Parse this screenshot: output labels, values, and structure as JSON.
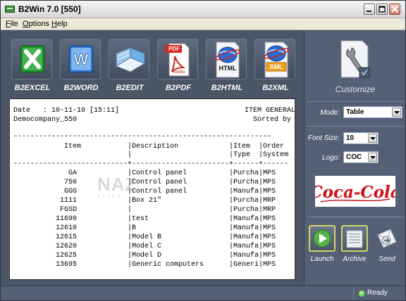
{
  "window": {
    "title": "B2Win 7.0 [550]"
  },
  "menu": {
    "file": {
      "first": "F",
      "rest": "ile"
    },
    "options": {
      "first": "O",
      "rest": "ptions"
    },
    "help": {
      "first": "H",
      "rest": "elp"
    }
  },
  "toolbar": {
    "items": [
      {
        "label": "B2EXCEL",
        "icon": "excel-icon"
      },
      {
        "label": "B2WORD",
        "icon": "word-icon"
      },
      {
        "label": "B2EDIT",
        "icon": "edit-book-icon"
      },
      {
        "label": "B2PDF",
        "icon": "pdf-icon",
        "icon_text": "PDF",
        "sub_text": "Adobe"
      },
      {
        "label": "B2HTML",
        "icon": "html-globe-icon",
        "icon_text": "HTML"
      },
      {
        "label": "B2XML",
        "icon": "xml-globe-icon",
        "icon_text": "XML"
      }
    ]
  },
  "preview": {
    "date_line": "Date   : 10-11-10 [15:11]",
    "company": "Democompany_550",
    "header_right_1": "ITEM GENERAL",
    "header_right_2": "Sorted by",
    "rule": "-------------------------------------------------------------",
    "col_header_1": "            Item           |Description            |Item  |Order",
    "col_header_2": "                           |                       |Type  |System",
    "col_rule": "---------------------------+-----------------------+------+------",
    "rows": [
      "             GA            |Control panel          |Purcha|MPS",
      "            750            |Control panel          |Purcha|MPS",
      "            GGG            |Control panel          |Manufa|MPS",
      "           1111            |Box 21\"                |Purcha|MRP",
      "           FGSD            |                       |Purcha|MRP",
      "          11690            |test                   |Manufa|MPS",
      "          12610            |B                      |Manufa|MPS",
      "          12615            |Model B                |Manufa|MPS",
      "          12620            |Model C                |Manufa|MPS",
      "          12625            |Model D                |Manufa|MPS",
      "          13695            |Generic computers      |Generi|MPS"
    ],
    "watermark": "NAZ",
    "watermark_sub": "NAZAR"
  },
  "side_panel": {
    "customize_label": "Customize",
    "mode_label": "Mode:",
    "mode_value": "Table",
    "font_size_label": "Font Size:",
    "font_size_value": "10",
    "logo_label": "Logo:",
    "logo_value": "COC",
    "logo_image_text": "Coca-Cola",
    "actions": [
      {
        "label": "Launch",
        "icon": "play-icon"
      },
      {
        "label": "Archive",
        "icon": "archive-box-icon"
      },
      {
        "label": "Send",
        "icon": "send-envelope-icon"
      }
    ]
  },
  "status": {
    "text": "Ready"
  },
  "colors": {
    "panel_bg": "#4a5566",
    "side_panel_bg": "#556075",
    "highlight_border": "#cfd66a",
    "coke_red": "#d0101a",
    "status_green": "#2fa51b"
  }
}
